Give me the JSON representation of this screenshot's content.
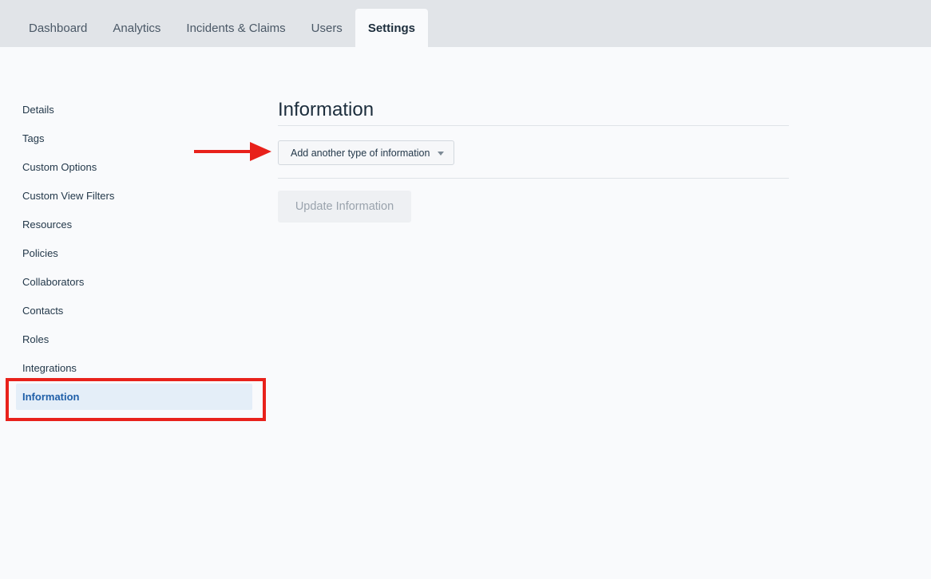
{
  "tabs": [
    {
      "label": "Dashboard"
    },
    {
      "label": "Analytics"
    },
    {
      "label": "Incidents & Claims"
    },
    {
      "label": "Users"
    },
    {
      "label": "Settings",
      "active": true
    }
  ],
  "sidebar": {
    "items": [
      {
        "label": "Details"
      },
      {
        "label": "Tags"
      },
      {
        "label": "Custom Options"
      },
      {
        "label": "Custom View Filters"
      },
      {
        "label": "Resources"
      },
      {
        "label": "Policies"
      },
      {
        "label": "Collaborators"
      },
      {
        "label": "Contacts"
      },
      {
        "label": "Roles"
      },
      {
        "label": "Integrations"
      },
      {
        "label": "Information",
        "active": true
      }
    ]
  },
  "main": {
    "title": "Information",
    "add_dropdown_label": "Add another type of information",
    "update_button_label": "Update Information"
  },
  "colors": {
    "accent": "#1f5fa8",
    "annotation": "#e8211b"
  }
}
